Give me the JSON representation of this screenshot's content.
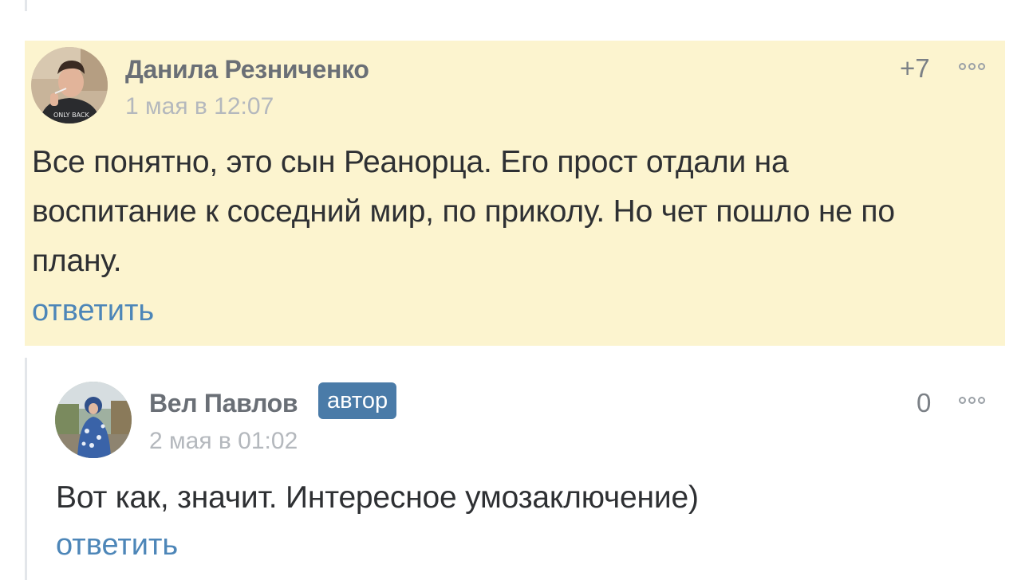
{
  "comments": [
    {
      "author": "Данила Резниченко",
      "date": "1 мая в 12:07",
      "score": "+7",
      "text_lines": [
        "Все понятно, это сын Реанорца. Его прост отдали на",
        "воспитание к соседний мир, по приколу. Но чет пошло не по",
        "плану."
      ],
      "reply_label": "ответить",
      "highlight_color": "#fcf4cf",
      "avatar_shirt_text": "ONLY BACK"
    },
    {
      "author": "Вел Павлов",
      "badge": "автор",
      "date": "2 мая в 01:02",
      "score": "0",
      "text": "Вот как, значит. Интересное умозаключение)",
      "reply_label": "ответить"
    }
  ],
  "icons": {
    "more": "more-options-icon"
  },
  "colors": {
    "link": "#4d86b8",
    "badge": "#4a7ba8",
    "author": "#6a6f76",
    "date": "#b4b8bd"
  }
}
